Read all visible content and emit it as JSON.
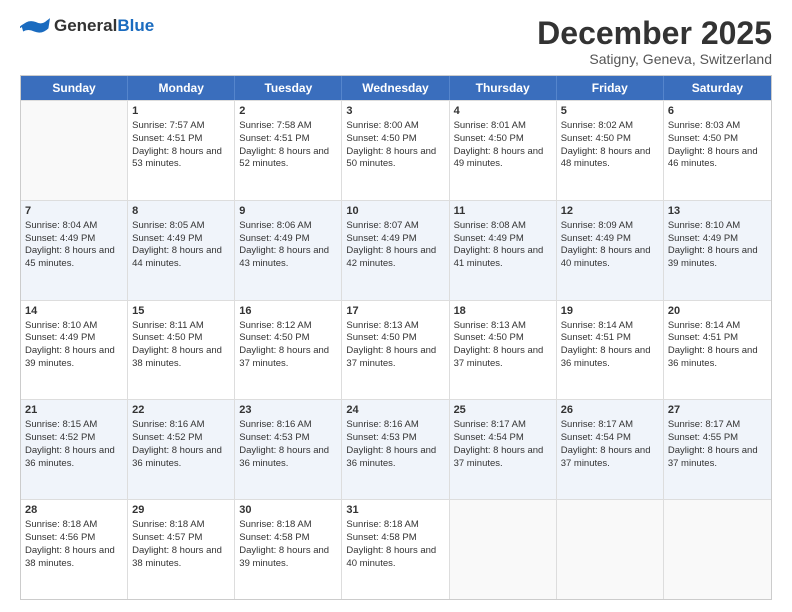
{
  "header": {
    "logo_general": "General",
    "logo_blue": "Blue",
    "month": "December 2025",
    "location": "Satigny, Geneva, Switzerland"
  },
  "weekdays": [
    "Sunday",
    "Monday",
    "Tuesday",
    "Wednesday",
    "Thursday",
    "Friday",
    "Saturday"
  ],
  "rows": [
    [
      {
        "day": "",
        "empty": true
      },
      {
        "day": "1",
        "sunrise": "Sunrise: 7:57 AM",
        "sunset": "Sunset: 4:51 PM",
        "daylight": "Daylight: 8 hours and 53 minutes."
      },
      {
        "day": "2",
        "sunrise": "Sunrise: 7:58 AM",
        "sunset": "Sunset: 4:51 PM",
        "daylight": "Daylight: 8 hours and 52 minutes."
      },
      {
        "day": "3",
        "sunrise": "Sunrise: 8:00 AM",
        "sunset": "Sunset: 4:50 PM",
        "daylight": "Daylight: 8 hours and 50 minutes."
      },
      {
        "day": "4",
        "sunrise": "Sunrise: 8:01 AM",
        "sunset": "Sunset: 4:50 PM",
        "daylight": "Daylight: 8 hours and 49 minutes."
      },
      {
        "day": "5",
        "sunrise": "Sunrise: 8:02 AM",
        "sunset": "Sunset: 4:50 PM",
        "daylight": "Daylight: 8 hours and 48 minutes."
      },
      {
        "day": "6",
        "sunrise": "Sunrise: 8:03 AM",
        "sunset": "Sunset: 4:50 PM",
        "daylight": "Daylight: 8 hours and 46 minutes."
      }
    ],
    [
      {
        "day": "7",
        "sunrise": "Sunrise: 8:04 AM",
        "sunset": "Sunset: 4:49 PM",
        "daylight": "Daylight: 8 hours and 45 minutes."
      },
      {
        "day": "8",
        "sunrise": "Sunrise: 8:05 AM",
        "sunset": "Sunset: 4:49 PM",
        "daylight": "Daylight: 8 hours and 44 minutes."
      },
      {
        "day": "9",
        "sunrise": "Sunrise: 8:06 AM",
        "sunset": "Sunset: 4:49 PM",
        "daylight": "Daylight: 8 hours and 43 minutes."
      },
      {
        "day": "10",
        "sunrise": "Sunrise: 8:07 AM",
        "sunset": "Sunset: 4:49 PM",
        "daylight": "Daylight: 8 hours and 42 minutes."
      },
      {
        "day": "11",
        "sunrise": "Sunrise: 8:08 AM",
        "sunset": "Sunset: 4:49 PM",
        "daylight": "Daylight: 8 hours and 41 minutes."
      },
      {
        "day": "12",
        "sunrise": "Sunrise: 8:09 AM",
        "sunset": "Sunset: 4:49 PM",
        "daylight": "Daylight: 8 hours and 40 minutes."
      },
      {
        "day": "13",
        "sunrise": "Sunrise: 8:10 AM",
        "sunset": "Sunset: 4:49 PM",
        "daylight": "Daylight: 8 hours and 39 minutes."
      }
    ],
    [
      {
        "day": "14",
        "sunrise": "Sunrise: 8:10 AM",
        "sunset": "Sunset: 4:49 PM",
        "daylight": "Daylight: 8 hours and 39 minutes."
      },
      {
        "day": "15",
        "sunrise": "Sunrise: 8:11 AM",
        "sunset": "Sunset: 4:50 PM",
        "daylight": "Daylight: 8 hours and 38 minutes."
      },
      {
        "day": "16",
        "sunrise": "Sunrise: 8:12 AM",
        "sunset": "Sunset: 4:50 PM",
        "daylight": "Daylight: 8 hours and 37 minutes."
      },
      {
        "day": "17",
        "sunrise": "Sunrise: 8:13 AM",
        "sunset": "Sunset: 4:50 PM",
        "daylight": "Daylight: 8 hours and 37 minutes."
      },
      {
        "day": "18",
        "sunrise": "Sunrise: 8:13 AM",
        "sunset": "Sunset: 4:50 PM",
        "daylight": "Daylight: 8 hours and 37 minutes."
      },
      {
        "day": "19",
        "sunrise": "Sunrise: 8:14 AM",
        "sunset": "Sunset: 4:51 PM",
        "daylight": "Daylight: 8 hours and 36 minutes."
      },
      {
        "day": "20",
        "sunrise": "Sunrise: 8:14 AM",
        "sunset": "Sunset: 4:51 PM",
        "daylight": "Daylight: 8 hours and 36 minutes."
      }
    ],
    [
      {
        "day": "21",
        "sunrise": "Sunrise: 8:15 AM",
        "sunset": "Sunset: 4:52 PM",
        "daylight": "Daylight: 8 hours and 36 minutes."
      },
      {
        "day": "22",
        "sunrise": "Sunrise: 8:16 AM",
        "sunset": "Sunset: 4:52 PM",
        "daylight": "Daylight: 8 hours and 36 minutes."
      },
      {
        "day": "23",
        "sunrise": "Sunrise: 8:16 AM",
        "sunset": "Sunset: 4:53 PM",
        "daylight": "Daylight: 8 hours and 36 minutes."
      },
      {
        "day": "24",
        "sunrise": "Sunrise: 8:16 AM",
        "sunset": "Sunset: 4:53 PM",
        "daylight": "Daylight: 8 hours and 36 minutes."
      },
      {
        "day": "25",
        "sunrise": "Sunrise: 8:17 AM",
        "sunset": "Sunset: 4:54 PM",
        "daylight": "Daylight: 8 hours and 37 minutes."
      },
      {
        "day": "26",
        "sunrise": "Sunrise: 8:17 AM",
        "sunset": "Sunset: 4:54 PM",
        "daylight": "Daylight: 8 hours and 37 minutes."
      },
      {
        "day": "27",
        "sunrise": "Sunrise: 8:17 AM",
        "sunset": "Sunset: 4:55 PM",
        "daylight": "Daylight: 8 hours and 37 minutes."
      }
    ],
    [
      {
        "day": "28",
        "sunrise": "Sunrise: 8:18 AM",
        "sunset": "Sunset: 4:56 PM",
        "daylight": "Daylight: 8 hours and 38 minutes."
      },
      {
        "day": "29",
        "sunrise": "Sunrise: 8:18 AM",
        "sunset": "Sunset: 4:57 PM",
        "daylight": "Daylight: 8 hours and 38 minutes."
      },
      {
        "day": "30",
        "sunrise": "Sunrise: 8:18 AM",
        "sunset": "Sunset: 4:58 PM",
        "daylight": "Daylight: 8 hours and 39 minutes."
      },
      {
        "day": "31",
        "sunrise": "Sunrise: 8:18 AM",
        "sunset": "Sunset: 4:58 PM",
        "daylight": "Daylight: 8 hours and 40 minutes."
      },
      {
        "day": "",
        "empty": true
      },
      {
        "day": "",
        "empty": true
      },
      {
        "day": "",
        "empty": true
      }
    ]
  ]
}
